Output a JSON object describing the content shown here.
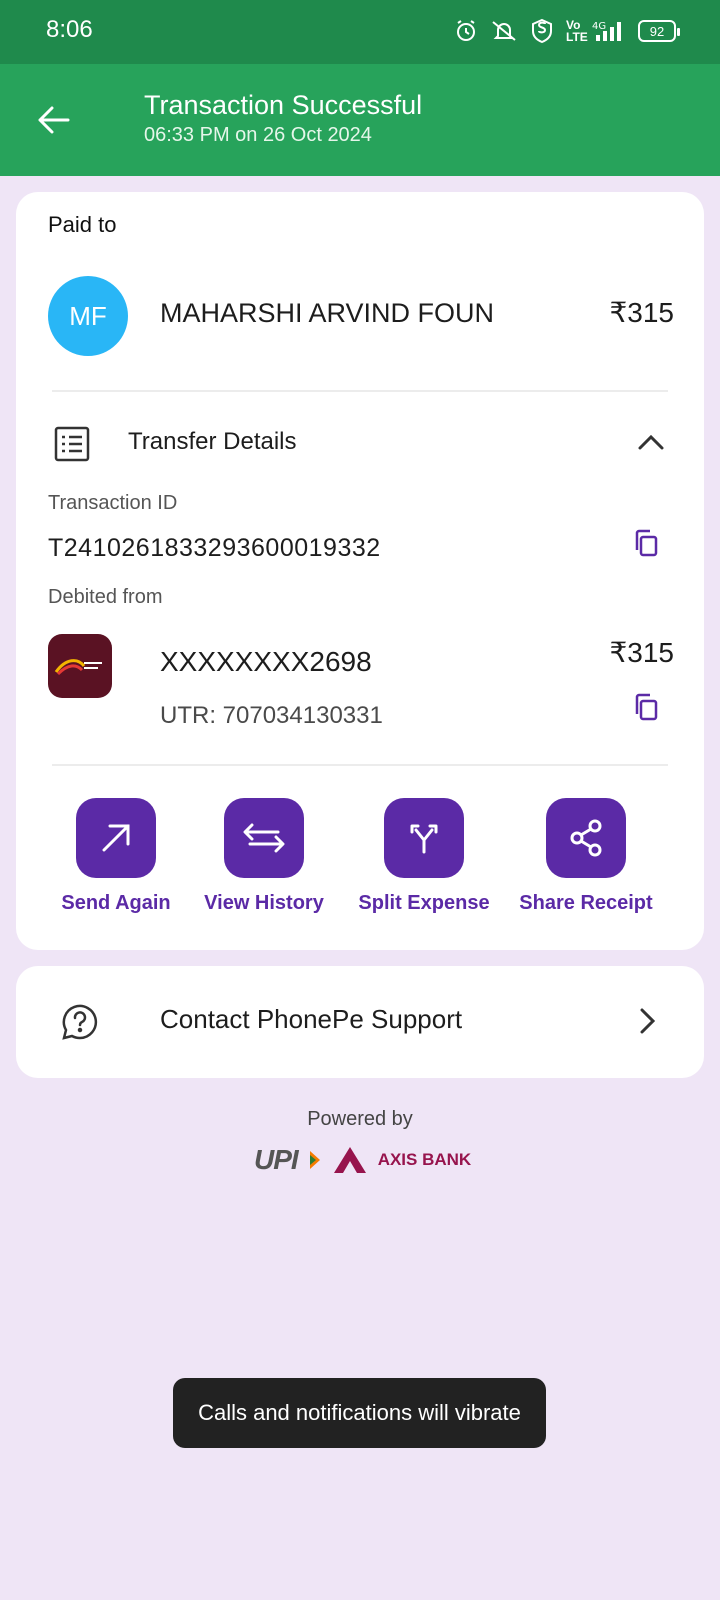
{
  "status_bar": {
    "time": "8:06",
    "battery": "92",
    "network": "4G",
    "volte": "Vo LTE"
  },
  "header": {
    "title": "Transaction Successful",
    "subtitle": "06:33 PM on 26 Oct 2024"
  },
  "payment": {
    "paid_to_label": "Paid to",
    "avatar_initials": "MF",
    "payee_name": "MAHARSHI ARVIND FOUN",
    "amount": "₹315"
  },
  "transfer_details": {
    "label": "Transfer Details",
    "transaction_id_label": "Transaction ID",
    "transaction_id": "T2410261833293600019332",
    "debited_from_label": "Debited from",
    "account": "XXXXXXXX2698",
    "amount": "₹315",
    "utr": "UTR: 707034130331"
  },
  "actions": [
    {
      "label": "Send Again",
      "icon": "arrow-up-right-icon"
    },
    {
      "label": "View History",
      "icon": "transfer-arrows-icon"
    },
    {
      "label": "Split Expense",
      "icon": "split-icon"
    },
    {
      "label": "Share Receipt",
      "icon": "share-icon"
    }
  ],
  "support": {
    "label": "Contact PhonePe Support"
  },
  "footer": {
    "powered_by": "Powered by",
    "upi": "UPI",
    "bank": "AXIS BANK"
  },
  "toast": "Calls and notifications will vibrate",
  "colors": {
    "header_green": "#27A35B",
    "status_green": "#1F8A4C",
    "accent_purple": "#5B2AA6",
    "background": "#EFE5F6",
    "avatar_blue": "#29B6F6"
  }
}
